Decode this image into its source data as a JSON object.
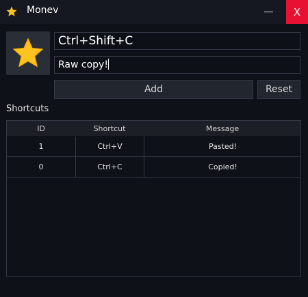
{
  "window": {
    "title": "Monev",
    "minimize_symbol": "—",
    "close_symbol": "X",
    "close_color": "#e81133"
  },
  "icons": {
    "app": "star-icon",
    "preview": "star-icon"
  },
  "form": {
    "shortcut_value": "Ctrl+Shift+C",
    "message_value": "Raw copy!",
    "add_label": "Add",
    "reset_label": "Reset"
  },
  "shortcuts": {
    "section_label": "Shortcuts",
    "columns": [
      "ID",
      "Shortcut",
      "Message"
    ],
    "rows": [
      {
        "id": "1",
        "shortcut": "Ctrl+V",
        "message": "Pasted!"
      },
      {
        "id": "0",
        "shortcut": "Ctrl+C",
        "message": "Copied!"
      }
    ]
  },
  "colors": {
    "background": "#0e1117",
    "star": "#fdc31f"
  }
}
